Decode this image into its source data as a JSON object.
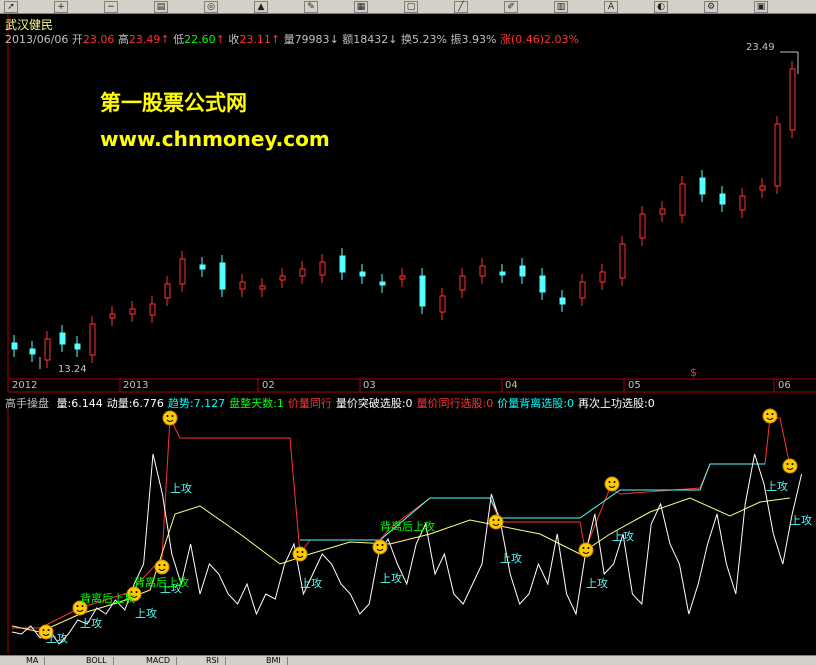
{
  "stock": {
    "name": "武汉健民"
  },
  "info_bar": {
    "date": "2013/06/06",
    "open_label": "开",
    "open": "23.06",
    "high_label": "高",
    "high": "23.49",
    "low_label": "低",
    "low": "22.60",
    "close_label": "收",
    "close": "23.11",
    "volume_label": "量",
    "volume": "79983",
    "amount_label": "额",
    "amount": "18432",
    "turnover_label": "换",
    "turnover": "5.23%",
    "amplitude_label": "振",
    "amplitude": "3.93%",
    "change_label": "涨",
    "change": "(0.46)2.03%"
  },
  "watermark": {
    "line1": "第一股票公式网",
    "line2": "www.chnmoney.com"
  },
  "price_marks": {
    "max": "23.49",
    "min": "13.24",
    "flag": "$"
  },
  "time_axis": [
    "2012",
    "2013",
    "02",
    "03",
    "04",
    "05",
    "06"
  ],
  "indicator_bar": {
    "name": "高手操盘",
    "items": [
      {
        "label": "量:",
        "value": "6.144",
        "color": "#ffffff"
      },
      {
        "label": "动量:",
        "value": "6.776",
        "color": "#ffffff"
      },
      {
        "label": "趋势:",
        "value": "7.127",
        "color": "#00ffff"
      },
      {
        "label": "盘整天数:",
        "value": "1",
        "color": "#00ff00"
      },
      {
        "label": "价量同行",
        "value": "",
        "color": "#ff3333"
      },
      {
        "label": "量价突破选股:",
        "value": "0",
        "color": "#ffffff"
      },
      {
        "label": "量价同行选股:",
        "value": "0",
        "color": "#ff3333"
      },
      {
        "label": "价量背离选股:",
        "value": "0",
        "color": "#00ffff"
      },
      {
        "label": "再次上功选股:",
        "value": "0",
        "color": "#ffffff"
      }
    ]
  },
  "signals": {
    "attack": "上攻",
    "divergence": "背离后上攻"
  },
  "tabs": [
    "MA",
    "BOLL",
    "MACD",
    "RSI",
    "BMI"
  ],
  "toolbar_icons": [
    "arrow-icon",
    "zoom-in-icon",
    "zoom-out-icon",
    "chart-icon",
    "globe-icon",
    "alert-icon",
    "pen-icon",
    "grid-icon",
    "window-icon",
    "line-icon",
    "draw-icon",
    "bars-icon",
    "text-icon",
    "color-icon",
    "settings-icon",
    "lock-icon"
  ],
  "colors": {
    "up": "#ff3232",
    "down": "#54ffff",
    "watermark": "#ffff00",
    "axis": "#b00000"
  }
}
